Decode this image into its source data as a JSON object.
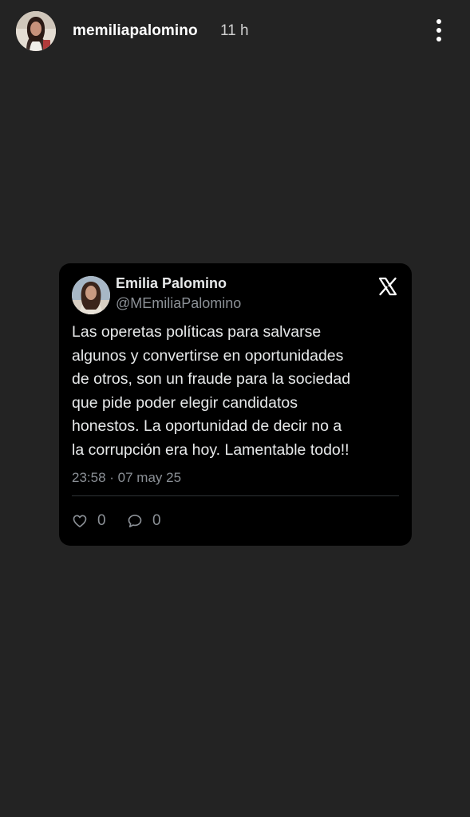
{
  "story": {
    "username": "memiliapalomino",
    "time": "11 h",
    "avatar_icon": "profile-photo",
    "more_icon": "more-vertical-icon",
    "background_color": "#232323"
  },
  "tweet": {
    "author_name": "Emilia Palomino",
    "handle": "@MEmiliaPalomino",
    "text": "Las operetas políticas para salvarse\nalgunos y convertirse en oportunidades\nde otros, son un fraude para la sociedad\nque pide poder elegir candidatos\nhonestos. La oportunidad  de decir no a\nla corrupción era hoy. Lamentable todo!!",
    "timestamp": "23:58 · 07 may 25",
    "likes": "0",
    "replies": "0",
    "platform_icon": "x-logo-icon",
    "card_color": "#000000",
    "secondary_text_color": "#8b9096"
  }
}
